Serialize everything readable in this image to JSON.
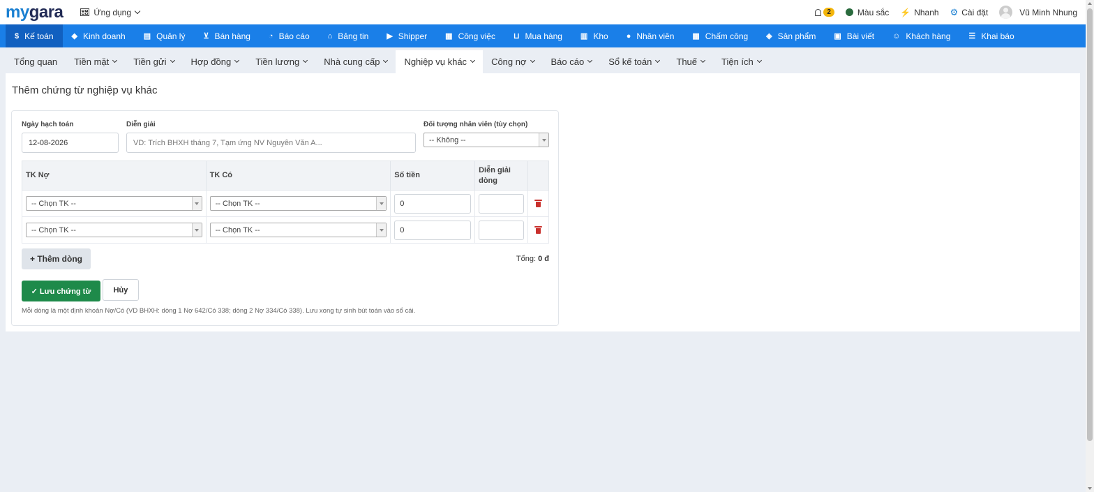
{
  "brand": {
    "logo_a": "my",
    "logo_b": "gara"
  },
  "topbar": {
    "apps_label": "Ứng dụng",
    "notifications_count": "2",
    "color_label": "Màu sắc",
    "quick_label": "Nhanh",
    "settings_label": "Cài đặt",
    "user_name": "Vũ Minh Nhung"
  },
  "main_nav": [
    {
      "label": "Kế toán",
      "icon": "$"
    },
    {
      "label": "Kinh doanh",
      "icon": "◆"
    },
    {
      "label": "Quản lý",
      "icon": "▤"
    },
    {
      "label": "Bán hàng",
      "icon": "⊻"
    },
    {
      "label": "Báo cáo",
      "icon": "◔"
    },
    {
      "label": "Bảng tin",
      "icon": "⌂"
    },
    {
      "label": "Shipper",
      "icon": "▶"
    },
    {
      "label": "Công việc",
      "icon": "▦"
    },
    {
      "label": "Mua hàng",
      "icon": "⊔"
    },
    {
      "label": "Kho",
      "icon": "▥"
    },
    {
      "label": "Nhân viên",
      "icon": "●"
    },
    {
      "label": "Chấm công",
      "icon": "▦"
    },
    {
      "label": "Sản phẩm",
      "icon": "◈"
    },
    {
      "label": "Bài viết",
      "icon": "▣"
    },
    {
      "label": "Khách hàng",
      "icon": "☺"
    },
    {
      "label": "Khai báo",
      "icon": "☰"
    }
  ],
  "sub_nav": [
    "Tổng quan",
    "Tiền mặt",
    "Tiền gửi",
    "Hợp đồng",
    "Tiền lương",
    "Nhà cung cấp",
    "Nghiệp vụ khác",
    "Công nợ",
    "Báo cáo",
    "Sổ kế toán",
    "Thuế",
    "Tiện ích"
  ],
  "page": {
    "title": "Thêm chứng từ nghiệp vụ khác"
  },
  "form": {
    "date_label": "Ngày hạch toán",
    "date_value": "12-08-2026",
    "desc_label": "Diễn giải",
    "desc_placeholder": "VD: Trích BHXH tháng 7, Tạm ứng NV Nguyễn Văn A...",
    "employee_label": "Đối tượng nhân viên (tùy chọn)",
    "employee_value": "-- Không --"
  },
  "table": {
    "headers": {
      "debit": "TK Nợ",
      "credit": "TK Có",
      "amount": "Số tiền",
      "line_desc": "Diễn giải dòng"
    },
    "rows": [
      {
        "debit": "-- Chọn TK --",
        "credit": "-- Chọn TK --",
        "amount": "0",
        "line_desc": ""
      },
      {
        "debit": "-- Chọn TK --",
        "credit": "-- Chọn TK --",
        "amount": "0",
        "line_desc": ""
      }
    ]
  },
  "actions": {
    "add_line": "+ Thêm dòng",
    "total_label": "Tổng:",
    "total_value": "0 đ",
    "save": "✓ Lưu chứng từ",
    "cancel": "Hủy"
  },
  "hint": "Mỗi dòng là một định khoản Nợ/Có (VD BHXH: dòng 1 Nợ 642/Có 338; dòng 2 Nợ 334/Có 338). Lưu xong tự sinh bút toán vào sổ cái."
}
